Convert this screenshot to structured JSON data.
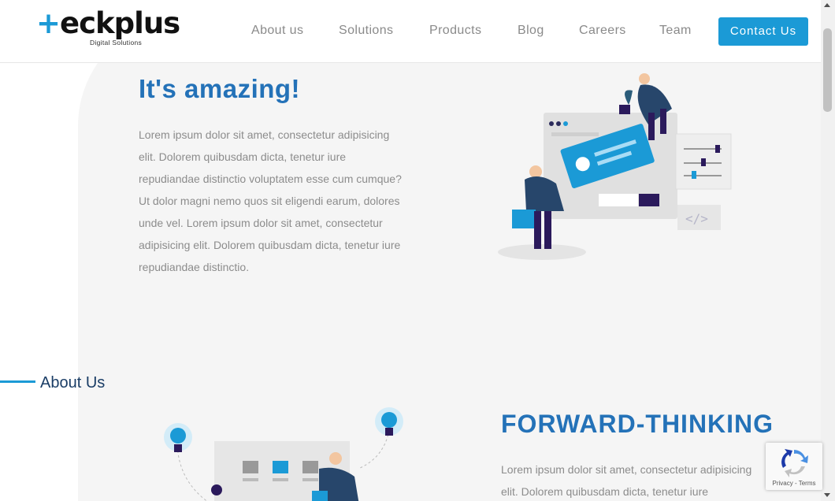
{
  "header": {
    "logo_word_main": "teckplus",
    "logo_tagline": "Digital Solutions",
    "nav": [
      "About us",
      "Solutions",
      "Products",
      "Blog",
      "Careers",
      "Team"
    ],
    "contact_label": "Contact Us"
  },
  "section1": {
    "heading": "It's amazing!",
    "paragraph": "Lorem ipsum dolor sit amet, consectetur adipisicing elit. Dolorem quibusdam dicta, tenetur iure repudiandae distinctio voluptatem esse cum cumque? Ut dolor magni nemo quos sit eligendi earum, dolores unde vel. Lorem ipsum dolor sit amet, consectetur adipisicing elit. Dolorem quibusdam dicta, tenetur iure repudiandae distinctio."
  },
  "about": {
    "label": "About Us",
    "heading": "FORWARD-THINKING",
    "paragraph": "Lorem ipsum dolor sit amet, consectetur adipisicing elit. Dolorem quibusdam dicta, tenetur iure"
  },
  "recaptcha": {
    "links": "Privacy - Terms"
  },
  "colors": {
    "accent": "#1b9ad6",
    "heading": "#2472b8",
    "nav_text": "#8a8a8a",
    "body_text": "#8c8c8c"
  }
}
